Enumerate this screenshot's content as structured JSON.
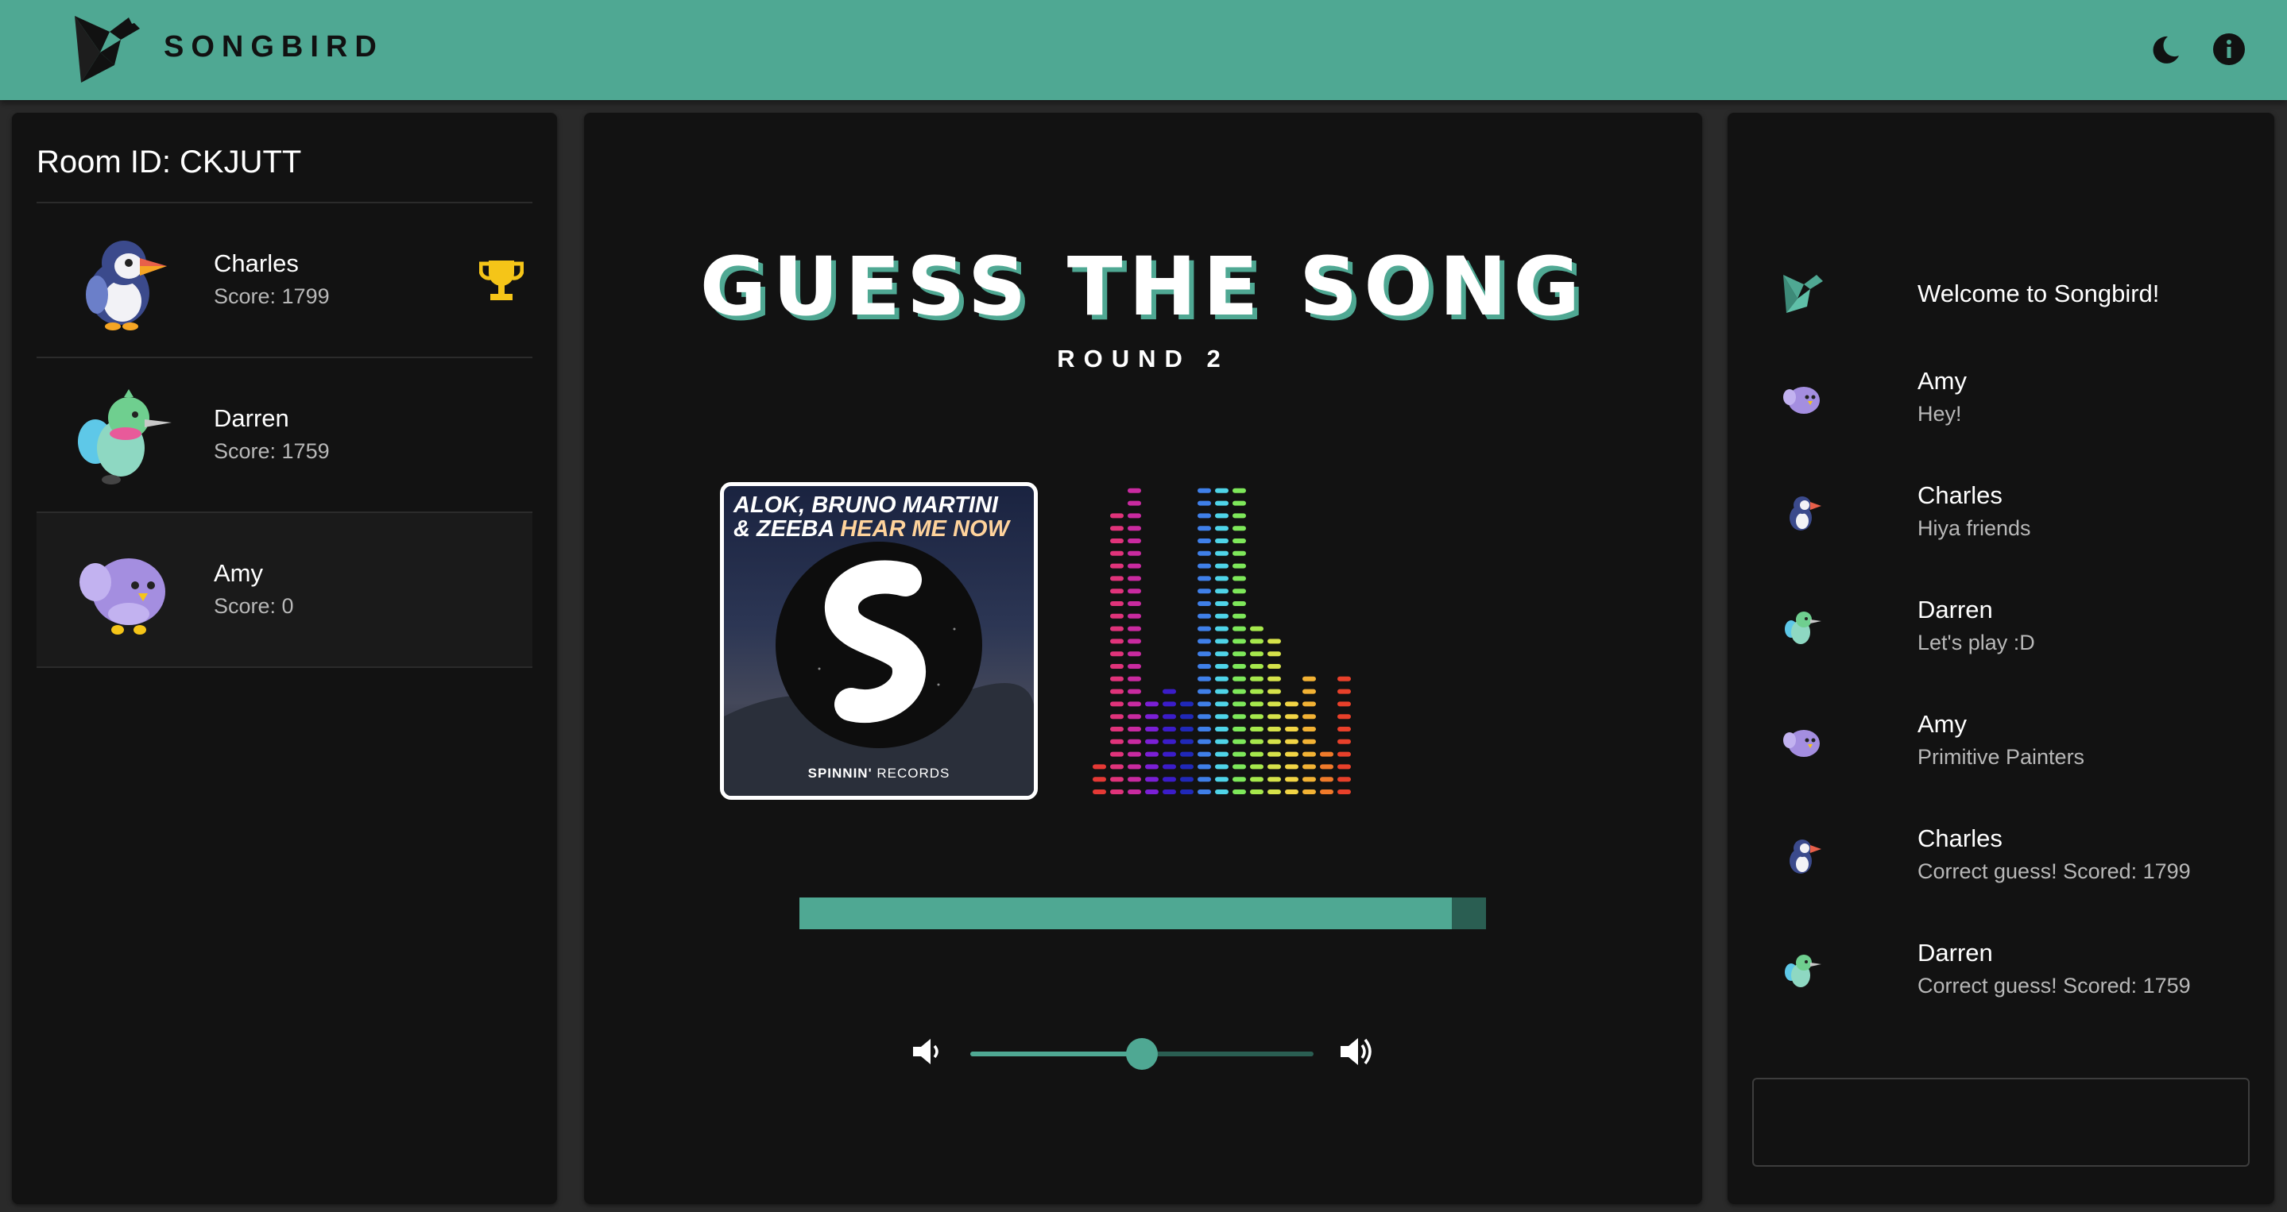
{
  "app": {
    "name": "SONGBIRD",
    "logo_icon": "bird-logo-icon",
    "accent": "#4fa893"
  },
  "header": {
    "dark_mode_icon": "moon-icon",
    "info_icon": "info-icon"
  },
  "room": {
    "label": "Room ID: CKJUTT"
  },
  "players": [
    {
      "name": "Charles",
      "score": "Score: 1799",
      "avatar": "puffin-avatar",
      "leader": true
    },
    {
      "name": "Darren",
      "score": "Score: 1759",
      "avatar": "green-bird-avatar",
      "leader": false
    },
    {
      "name": "Amy",
      "score": "Score: 0",
      "avatar": "purple-bird-avatar",
      "leader": false
    }
  ],
  "game": {
    "title": "GUESS THE SONG",
    "round": "ROUND 2",
    "album": {
      "line1": "ALOK, BRUNO MARTINI",
      "line2_prefix": "& ZEEBA ",
      "line2_highlight": "HEAR ME NOW",
      "label_bold": "SPINNIN'",
      "label_rest": " RECORDS"
    },
    "equalizer": {
      "levels": [
        3,
        23,
        25,
        8,
        9,
        8,
        25,
        25,
        25,
        14,
        13,
        8,
        10,
        4,
        10
      ],
      "max_level": 25,
      "colors": [
        "#e53935",
        "#e0337a",
        "#c92aa0",
        "#7b1fd6",
        "#3b1cc9",
        "#2028b8",
        "#3f7fe8",
        "#4fd4e8",
        "#7ee85a",
        "#a6e84c",
        "#d6e24a",
        "#f2d545",
        "#f2b234",
        "#f07a2a",
        "#e8402a"
      ]
    },
    "progress": 0.95,
    "volume": 0.5
  },
  "chat": {
    "messages": [
      {
        "name": "",
        "text": "Welcome to Songbird!",
        "icon": "songbird-logo-icon",
        "system": true
      },
      {
        "name": "Amy",
        "text": "Hey!",
        "icon": "purple-bird-icon"
      },
      {
        "name": "Charles",
        "text": "Hiya friends",
        "icon": "puffin-icon"
      },
      {
        "name": "Darren",
        "text": "Let's play :D",
        "icon": "green-bird-icon"
      },
      {
        "name": "Amy",
        "text": "Primitive Painters",
        "icon": "purple-bird-icon"
      },
      {
        "name": "Charles",
        "text": "Correct guess! Scored: 1799",
        "icon": "puffin-icon"
      },
      {
        "name": "Darren",
        "text": "Correct guess! Scored: 1759",
        "icon": "green-bird-icon"
      }
    ],
    "input_placeholder": ""
  }
}
